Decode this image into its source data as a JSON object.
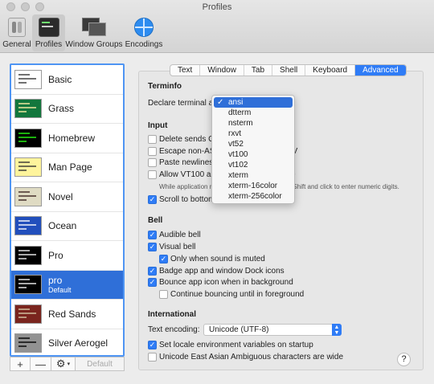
{
  "window": {
    "title": "Profiles"
  },
  "toolbar": {
    "items": [
      {
        "label": "General",
        "icon": "general-icon",
        "active": false
      },
      {
        "label": "Profiles",
        "icon": "profiles-icon",
        "active": true
      },
      {
        "label": "Window Groups",
        "icon": "window-groups-icon",
        "active": false
      },
      {
        "label": "Encodings",
        "icon": "globe-icon",
        "active": false
      }
    ]
  },
  "profiles": [
    {
      "name": "Basic",
      "bg": "#ffffff",
      "fg": "#333333"
    },
    {
      "name": "Grass",
      "bg": "#13773d",
      "fg": "#fff0a5"
    },
    {
      "name": "Homebrew",
      "bg": "#000000",
      "fg": "#28fe14"
    },
    {
      "name": "Man Page",
      "bg": "#fef49c",
      "fg": "#333333"
    },
    {
      "name": "Novel",
      "bg": "#dfdbc3",
      "fg": "#3b2322"
    },
    {
      "name": "Ocean",
      "bg": "#224fbc",
      "fg": "#ffffff"
    },
    {
      "name": "Pro",
      "bg": "#000000",
      "fg": "#f2f2f2"
    },
    {
      "name": "pro",
      "sub": "Default",
      "bg": "#000000",
      "fg": "#f2f2f2",
      "selected": true
    },
    {
      "name": "Red Sands",
      "bg": "#7a251e",
      "fg": "#d7c9a7"
    },
    {
      "name": "Silver Aerogel",
      "bg": "#929292",
      "fg": "#000000"
    }
  ],
  "list_buttons": {
    "add": "+",
    "remove": "—",
    "gear": "⚙",
    "default": "Default"
  },
  "tabs": [
    {
      "label": "Text",
      "active": false
    },
    {
      "label": "Window",
      "active": false
    },
    {
      "label": "Tab",
      "active": false
    },
    {
      "label": "Shell",
      "active": false
    },
    {
      "label": "Keyboard",
      "active": false
    },
    {
      "label": "Advanced",
      "active": true
    }
  ],
  "terminfo": {
    "heading": "Terminfo",
    "declare_label": "Declare terminal as:"
  },
  "input": {
    "heading": "Input",
    "options": [
      {
        "label": "Delete sends Control-H",
        "checked": false
      },
      {
        "label": "Escape non-ASCII input with Control-V",
        "checked": false
      },
      {
        "label": "Paste newlines as carriage returns",
        "checked": false
      },
      {
        "label": "Allow VT100 application keypad mode",
        "checked": false
      }
    ],
    "note": "While application mode is active, press Option-Shift and click to enter numeric digits.",
    "scroll": {
      "label": "Scroll to bottom on input",
      "checked": true
    }
  },
  "dropdown": {
    "items": [
      "ansi",
      "dtterm",
      "nsterm",
      "rxvt",
      "vt52",
      "vt100",
      "vt102",
      "xterm",
      "xterm-16color",
      "xterm-256color"
    ],
    "selected": "ansi",
    "check_mark": "✓"
  },
  "bell": {
    "heading": "Bell",
    "audible": {
      "label": "Audible bell",
      "checked": true
    },
    "visual": {
      "label": "Visual bell",
      "checked": true
    },
    "muted": {
      "label": "Only when sound is muted",
      "checked": true
    },
    "badge": {
      "label": "Badge app and window Dock icons",
      "checked": true
    },
    "bounce": {
      "label": "Bounce app icon when in background",
      "checked": true
    },
    "continue": {
      "label": "Continue bouncing until in foreground",
      "checked": false
    }
  },
  "international": {
    "heading": "International",
    "encoding_label": "Text encoding:",
    "encoding_value": "Unicode (UTF-8)",
    "locale": {
      "label": "Set locale environment variables on startup",
      "checked": true
    },
    "east_asian": {
      "label": "Unicode East Asian Ambiguous characters are wide",
      "checked": false
    }
  },
  "help_label": "?",
  "colors": {
    "accent": "#2f7cf6",
    "selection": "#2f6fd8"
  }
}
